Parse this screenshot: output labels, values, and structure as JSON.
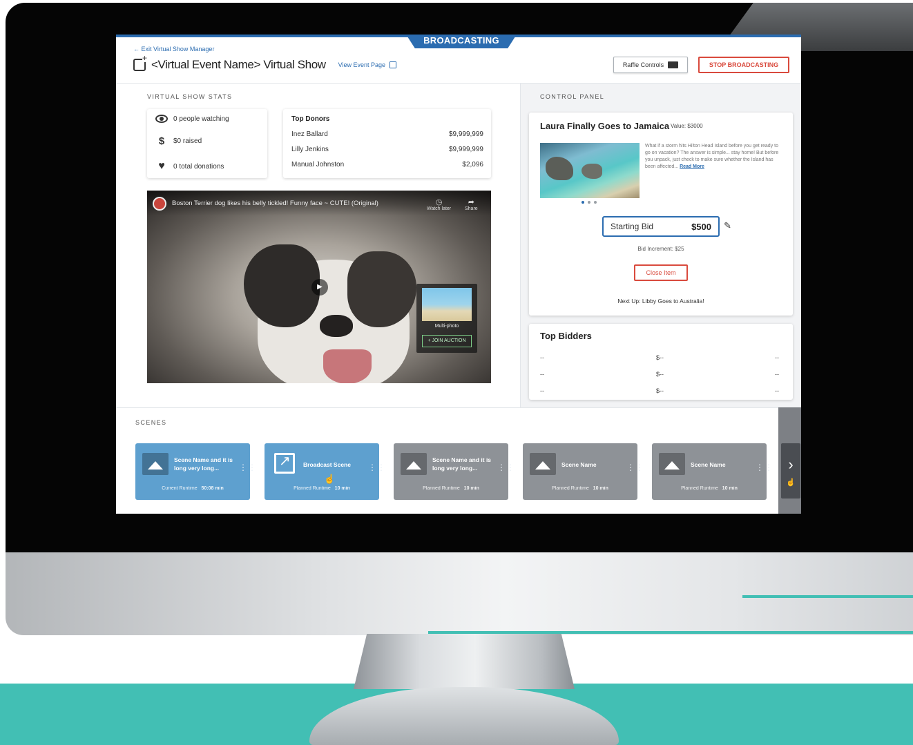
{
  "header": {
    "broadcast_tab": "BROADCASTING",
    "exit_link": "← Exit Virtual Show Manager",
    "page_title": "<Virtual Event Name> Virtual Show",
    "view_event_link": "View Event Page",
    "raffle_button": "Raffle Controls",
    "stop_button": "STOP BROADCASTING"
  },
  "stats": {
    "section_label": "VIRTUAL SHOW STATS",
    "watching": "0 people watching",
    "raised": "$0 raised",
    "donations": "0 total donations"
  },
  "donors": {
    "title": "Top Donors",
    "rows": [
      {
        "name": "Inez Ballard",
        "amount": "$9,999,999"
      },
      {
        "name": "Lilly Jenkins",
        "amount": "$9,999,999"
      },
      {
        "name": "Manual Johnston",
        "amount": "$2,096"
      }
    ]
  },
  "video": {
    "title": "Boston Terrier dog likes his belly tickled! Funny face ~ CUTE! (Original)",
    "watch_later": "Watch later",
    "share": "Share",
    "overlay_label": "Multi-photo",
    "overlay_join": "+ JOIN AUCTION"
  },
  "control_panel": {
    "section_label": "CONTROL PANEL",
    "item_title": "Laura Finally Goes to Jamaica",
    "item_value": "Value: $3000",
    "item_desc": "What if a storm hits Hilton Head Island before you get ready to go on vacation? The answer is simple... stay home! But before you unpack, just check to make sure whether the Island has been affected...",
    "read_more": "Read More",
    "bid_label": "Starting Bid",
    "bid_amount": "$500",
    "bid_increment": "Bid Increment: $25",
    "close_button": "Close Item",
    "next_up": "Next Up: Libby Goes to Australia!"
  },
  "bidders": {
    "title": "Top Bidders",
    "rows": [
      {
        "name": "--",
        "amount": "$--",
        "time": "--"
      },
      {
        "name": "--",
        "amount": "$--",
        "time": "--"
      },
      {
        "name": "--",
        "amount": "$--",
        "time": "--"
      }
    ]
  },
  "scenes": {
    "section_label": "SCENES",
    "items": [
      {
        "name": "Scene Name and it is long very long...",
        "runtime_label": "Current Runtime",
        "runtime": "50:08 min"
      },
      {
        "name": "Broadcast Scene",
        "runtime_label": "Planned Runtime",
        "runtime": "10 min"
      },
      {
        "name": "Scene Name and it is long very long...",
        "runtime_label": "Planned Runtime",
        "runtime": "10 min"
      },
      {
        "name": "Scene Name",
        "runtime_label": "Planned Runtime",
        "runtime": "10 min"
      },
      {
        "name": "Scene Name",
        "runtime_label": "Planned Runtime",
        "runtime": "10 min"
      }
    ]
  },
  "colors": {
    "brand_blue": "#2b6cb0",
    "stop_red": "#d94a3d",
    "teal": "#42bfb4",
    "active_scene": "#5ea0cf",
    "inactive_scene": "#8e9297"
  }
}
